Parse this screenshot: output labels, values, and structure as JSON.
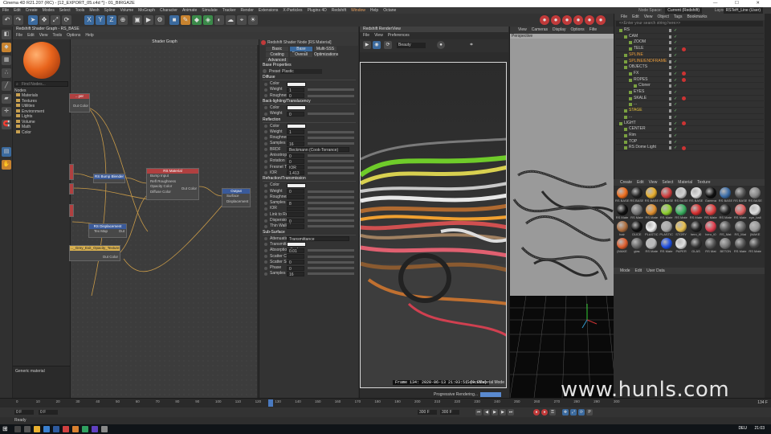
{
  "window": {
    "title": "Cinema 4D R21.207 (RC) - [12_EXPORT_05.c4d *] - 01_BIRGA2E",
    "controls": "— ☐ ✕"
  },
  "menu": [
    "File",
    "Edit",
    "Create",
    "Modes",
    "Select",
    "Tools",
    "Mesh",
    "Spline",
    "Volume",
    "MoGraph",
    "Character",
    "Animate",
    "Simulate",
    "Tracker",
    "Render",
    "Extensions",
    "X-Particles",
    "Plugins 4D",
    "Redshift",
    "Window",
    "Help",
    "Octane"
  ],
  "menu_right": {
    "node_space_label": "Node Space:",
    "node_space": "Current (Redshift)",
    "layout_label": "Layout:",
    "layout": "RSTeH_Line (User)"
  },
  "shader_graph": {
    "title": "Redshift Shader Graph - RS_BASE",
    "menus": [
      "File",
      "Edit",
      "View",
      "Tools",
      "Options",
      "Help"
    ],
    "panel_title": "Shader Graph",
    "find_placeholder": "Find Nodes...",
    "nodes_header": "Nodes",
    "categories": [
      "Materials",
      "Textures",
      "Utilities",
      "Environment",
      "Lights",
      "Volume",
      "Math",
      "Color"
    ],
    "description": "Generic material",
    "graph_nodes": {
      "bump": "RS Bump Blender",
      "material": "RS Material",
      "material_inputs": [
        "Bump Input",
        "Refl Roughness",
        "Opacity Color",
        "Diffuse Color"
      ],
      "material_out": "Out Color",
      "output": "Output",
      "output_ports": [
        "Surface",
        "Displacement"
      ],
      "displacement": "RS Displacement",
      "disp_in": "Tex Map",
      "disp_out": "Out",
      "texture": "..._Grey_Exit_Opacity_Texture",
      "texture_out": "Out Color",
      "left_top": "...yer",
      "left_out": "Out Color"
    }
  },
  "attributes": {
    "title": "Redshift Shader Node [RS Material]",
    "tabs": [
      "Basic",
      "Base Properties",
      "Multi-SSS",
      "Coating",
      "Overall",
      "Optimizations",
      "Advanced"
    ],
    "section": "Base Properties",
    "preset_label": "Preset",
    "preset": "Plastic",
    "groups": {
      "diffuse": "Diffuse",
      "back": "Back-lighting/Translucency",
      "reflection": "Reflection",
      "refraction": "Refraction/Transmission",
      "sss": "Sub-Surface"
    },
    "rows": [
      {
        "label": "Color",
        "value": ""
      },
      {
        "label": "Weight",
        "value": "1"
      },
      {
        "label": "Roughness",
        "value": "0"
      },
      {
        "label": "Color",
        "value": ""
      },
      {
        "label": "Weight",
        "value": "0"
      },
      {
        "label": "Color",
        "value": ""
      },
      {
        "label": "Weight",
        "value": "1"
      },
      {
        "label": "Roughness",
        "value": ""
      },
      {
        "label": "Samples",
        "value": "16"
      },
      {
        "label": "BRDF",
        "value": "Beckmann (Cook-Torrance)"
      },
      {
        "label": "Anisotropy",
        "value": "0"
      },
      {
        "label": "Rotation",
        "value": "0"
      },
      {
        "label": "Fresnel Type",
        "value": "IOR"
      },
      {
        "label": "IOR",
        "value": "1.413"
      },
      {
        "label": "Color",
        "value": ""
      },
      {
        "label": "Weight",
        "value": "0"
      },
      {
        "label": "Roughness",
        "value": ""
      },
      {
        "label": "Samples",
        "value": "8"
      },
      {
        "label": "IOR",
        "value": ""
      },
      {
        "label": "Link to Reflection",
        "value": ""
      },
      {
        "label": "Dispersion",
        "value": "0"
      },
      {
        "label": "Thin Walled",
        "value": ""
      },
      {
        "label": "Attenuation Units",
        "value": "Transmittance"
      },
      {
        "label": "Transmittance Color",
        "value": ""
      },
      {
        "label": "Absorption Scale",
        "value": "0.01"
      },
      {
        "label": "Scatter Coeff",
        "value": ""
      },
      {
        "label": "Scatter Scale",
        "value": "0"
      },
      {
        "label": "Phase",
        "value": "0"
      },
      {
        "label": "Samples",
        "value": "16"
      }
    ]
  },
  "renderview": {
    "title": "Redshift RenderView",
    "menus": [
      "File",
      "View",
      "Preferences"
    ],
    "beauty": "Beauty",
    "status": "Frame 134: 2020-06-13 21:03:51 (9.81s)",
    "select_mode": "Select Material Mode",
    "progress": "Progressive Rendering..."
  },
  "viewport": {
    "menus": [
      "View",
      "Cameras",
      "Display",
      "Options",
      "Filte"
    ],
    "label": "Perspective"
  },
  "objects": {
    "menus": [
      "File",
      "Edit",
      "View",
      "Object",
      "Tags",
      "Bookmarks"
    ],
    "search_placeholder": "<<Enter your search string here>>",
    "items": [
      {
        "name": "RS",
        "depth": 0,
        "color": "#c8c8c8"
      },
      {
        "name": "CAM",
        "depth": 1,
        "color": "#c8c8c8"
      },
      {
        "name": "ZOOM",
        "depth": 2,
        "color": "#c8c8c8"
      },
      {
        "name": "TELE",
        "depth": 2,
        "color": "#c8c8c8"
      },
      {
        "name": "SPLINE",
        "depth": 1,
        "color": "#e79a3a"
      },
      {
        "name": "SPLINE/ENDFRAME",
        "depth": 1,
        "color": "#e79a3a"
      },
      {
        "name": "OBJECTS",
        "depth": 1,
        "color": "#c8c8c8"
      },
      {
        "name": "FX",
        "depth": 2,
        "color": "#c8c8c8"
      },
      {
        "name": "ROPES",
        "depth": 2,
        "color": "#c8c8c8"
      },
      {
        "name": "Cloner",
        "depth": 3,
        "color": "#c8c8c8"
      },
      {
        "name": "EYES",
        "depth": 2,
        "color": "#c8c8c8"
      },
      {
        "name": "SKALE",
        "depth": 2,
        "color": "#c8c8c8"
      },
      {
        "name": "...",
        "depth": 2,
        "color": "#c8c8c8"
      },
      {
        "name": "STAGE",
        "depth": 1,
        "color": "#e7c03a"
      },
      {
        "name": "...",
        "depth": 1,
        "color": "#c8c8c8"
      },
      {
        "name": "LIGHT",
        "depth": 0,
        "color": "#c8c8c8"
      },
      {
        "name": "CENTER",
        "depth": 1,
        "color": "#c8c8c8"
      },
      {
        "name": "Rim",
        "depth": 1,
        "color": "#c8c8c8"
      },
      {
        "name": "TOP",
        "depth": 1,
        "color": "#c8c8c8"
      },
      {
        "name": "RS Dome Light",
        "depth": 1,
        "color": "#c8c8c8"
      }
    ]
  },
  "materials": {
    "menus": [
      "Create",
      "Edit",
      "View",
      "Select",
      "Material",
      "Texture"
    ],
    "items": [
      {
        "name": "RS BASE",
        "color": "#f07020"
      },
      {
        "name": "RS BASE",
        "color": "#222"
      },
      {
        "name": "RS BASE",
        "color": "#e8b030"
      },
      {
        "name": "RS BASE",
        "color": "#d04040"
      },
      {
        "name": "RS BASE",
        "color": "#d0d0d0"
      },
      {
        "name": "RS BASE",
        "color": "#e0e0e0"
      },
      {
        "name": "Gamma",
        "color": "#111"
      },
      {
        "name": "RS BASE",
        "color": "#3c6ea8"
      },
      {
        "name": "RS BASE",
        "color": "#555"
      },
      {
        "name": "RS BASE",
        "color": "#888"
      },
      {
        "name": "RS Mate",
        "color": "#111"
      },
      {
        "name": "RS Mate",
        "color": "#777"
      },
      {
        "name": "RS Mate",
        "color": "#e09030"
      },
      {
        "name": "RS Mate",
        "color": "#8fd030"
      },
      {
        "name": "RS Mate",
        "color": "#3ab060"
      },
      {
        "name": "RS Mate",
        "color": "#d83030"
      },
      {
        "name": "RS Mate",
        "color": "#e04040"
      },
      {
        "name": "RS Mate",
        "color": "#222"
      },
      {
        "name": "RS Mate",
        "color": "#e06060"
      },
      {
        "name": "eye_ball",
        "color": "#ddd"
      },
      {
        "name": "hair",
        "color": "#b07040"
      },
      {
        "name": "DUCE",
        "color": "#111"
      },
      {
        "name": "PLASTIC",
        "color": "#f0f0f0"
      },
      {
        "name": "PLASTIC",
        "color": "#aaa"
      },
      {
        "name": "STORY",
        "color": "#e8c050"
      },
      {
        "name": "hero_t0",
        "color": "#222"
      },
      {
        "name": "hero_t0",
        "color": "#e04050"
      },
      {
        "name": "RS_Mat",
        "color": "#555"
      },
      {
        "name": "RS_Mat",
        "color": "#666"
      },
      {
        "name": "(MAKE",
        "color": "#999"
      },
      {
        "name": "(MAKE",
        "color": "#e06030"
      },
      {
        "name": "glas",
        "color": "#666"
      },
      {
        "name": "RS Mate",
        "color": "#bbb"
      },
      {
        "name": "RS Mate",
        "color": "#2050e0"
      },
      {
        "name": "PAPER",
        "color": "#e0e0e0"
      },
      {
        "name": "GLAS",
        "color": "#333"
      },
      {
        "name": "RS Mat",
        "color": "#555"
      },
      {
        "name": "BETON",
        "color": "#777"
      },
      {
        "name": "RS Mate",
        "color": "#555"
      },
      {
        "name": "RS Mate",
        "color": "#444"
      }
    ]
  },
  "attr2": {
    "menus": [
      "Mode",
      "Edit",
      "User Data"
    ]
  },
  "timeline": {
    "ticks": [
      "0",
      "10",
      "20",
      "30",
      "40",
      "50",
      "60",
      "70",
      "80",
      "90",
      "100",
      "110",
      "120",
      "130",
      "140",
      "150",
      "160",
      "170",
      "180",
      "190",
      "200",
      "210",
      "220",
      "230",
      "240",
      "250",
      "260",
      "270",
      "280",
      "290",
      "300"
    ],
    "current": "134",
    "end": "134 F",
    "start_field": "0 F",
    "start_field2": "0 F",
    "end_field": "300 F",
    "end_field2": "300 F"
  },
  "statusbar": {
    "text": "Ready"
  },
  "watermark": "www.hunls.com",
  "taskbar": {
    "lang": "DEU",
    "time": "21:03"
  }
}
